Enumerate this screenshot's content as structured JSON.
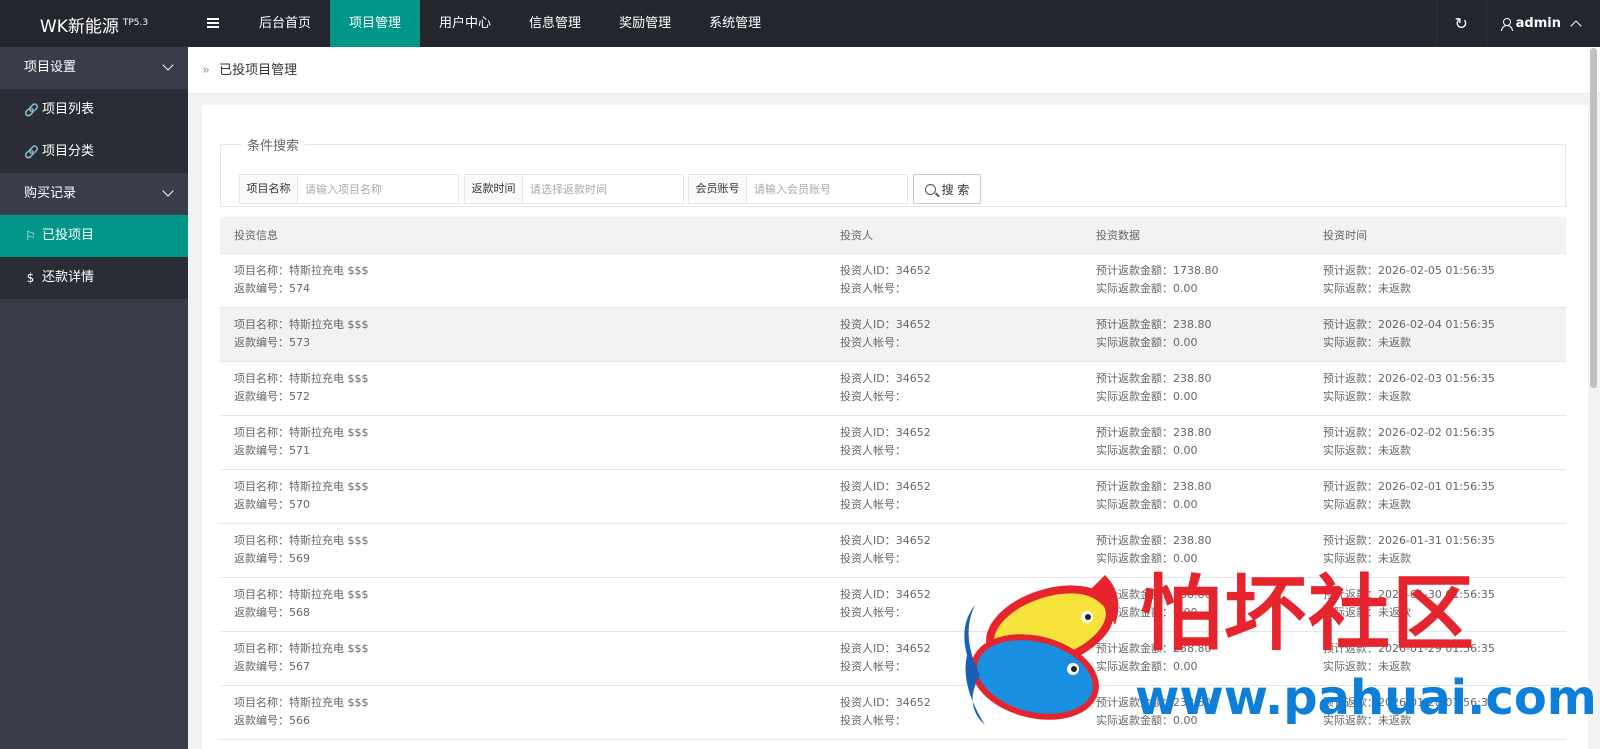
{
  "header": {
    "logo": "WK新能源",
    "version": "TP5.3",
    "nav": [
      {
        "label": "后台首页",
        "active": false
      },
      {
        "label": "项目管理",
        "active": true
      },
      {
        "label": "用户中心",
        "active": false
      },
      {
        "label": "信息管理",
        "active": false
      },
      {
        "label": "奖励管理",
        "active": false
      },
      {
        "label": "系统管理",
        "active": false
      }
    ],
    "refresh_icon": "↻",
    "user": "admin"
  },
  "sidebar": {
    "groups": [
      {
        "label": "项目设置",
        "items": [
          {
            "icon": "🔗",
            "label": "项目列表",
            "active": false
          },
          {
            "icon": "🔗",
            "label": "项目分类",
            "active": false
          }
        ]
      },
      {
        "label": "购买记录",
        "items": [
          {
            "icon": "⚐",
            "label": "已投项目",
            "active": true
          },
          {
            "icon": "$",
            "label": "还款详情",
            "active": false
          }
        ]
      }
    ]
  },
  "breadcrumb": {
    "current": "已投项目管理"
  },
  "search": {
    "legend": "条件搜索",
    "fields": [
      {
        "label": "项目名称",
        "placeholder": "请输入项目名称"
      },
      {
        "label": "返款时间",
        "placeholder": "请选择返款时间"
      },
      {
        "label": "会员账号",
        "placeholder": "请输入会员账号"
      }
    ],
    "button": "搜 索"
  },
  "table": {
    "columns": [
      "投资信息",
      "投资人",
      "投资数据",
      "投资时间"
    ],
    "rows": [
      {
        "name": "项目名称：特斯拉充电 $$$",
        "code": "返款编号：574",
        "inv_id": "投资人ID：34652",
        "inv_acct": "投资人帐号：",
        "est": "预计返款金额：1738.80",
        "act": "实际返款金额：0.00",
        "est_time": "预计返款：2026-02-05 01:56:35",
        "act_time": "实际返款：未返款"
      },
      {
        "name": "项目名称：特斯拉充电 $$$",
        "code": "返款编号：573",
        "inv_id": "投资人ID：34652",
        "inv_acct": "投资人帐号：",
        "est": "预计返款金额：238.80",
        "act": "实际返款金额：0.00",
        "est_time": "预计返款：2026-02-04 01:56:35",
        "act_time": "实际返款：未返款"
      },
      {
        "name": "项目名称：特斯拉充电 $$$",
        "code": "返款编号：572",
        "inv_id": "投资人ID：34652",
        "inv_acct": "投资人帐号：",
        "est": "预计返款金额：238.80",
        "act": "实际返款金额：0.00",
        "est_time": "预计返款：2026-02-03 01:56:35",
        "act_time": "实际返款：未返款"
      },
      {
        "name": "项目名称：特斯拉充电 $$$",
        "code": "返款编号：571",
        "inv_id": "投资人ID：34652",
        "inv_acct": "投资人帐号：",
        "est": "预计返款金额：238.80",
        "act": "实际返款金额：0.00",
        "est_time": "预计返款：2026-02-02 01:56:35",
        "act_time": "实际返款：未返款"
      },
      {
        "name": "项目名称：特斯拉充电 $$$",
        "code": "返款编号：570",
        "inv_id": "投资人ID：34652",
        "inv_acct": "投资人帐号：",
        "est": "预计返款金额：238.80",
        "act": "实际返款金额：0.00",
        "est_time": "预计返款：2026-02-01 01:56:35",
        "act_time": "实际返款：未返款"
      },
      {
        "name": "项目名称：特斯拉充电 $$$",
        "code": "返款编号：569",
        "inv_id": "投资人ID：34652",
        "inv_acct": "投资人帐号：",
        "est": "预计返款金额：238.80",
        "act": "实际返款金额：0.00",
        "est_time": "预计返款：2026-01-31 01:56:35",
        "act_time": "实际返款：未返款"
      },
      {
        "name": "项目名称：特斯拉充电 $$$",
        "code": "返款编号：568",
        "inv_id": "投资人ID：34652",
        "inv_acct": "投资人帐号：",
        "est": "预计返款金额：238.80",
        "act": "实际返款金额：0.00",
        "est_time": "预计返款：2026-01-30 01:56:35",
        "act_time": "实际返款：未返款"
      },
      {
        "name": "项目名称：特斯拉充电 $$$",
        "code": "返款编号：567",
        "inv_id": "投资人ID：34652",
        "inv_acct": "投资人帐号：",
        "est": "预计返款金额：238.80",
        "act": "实际返款金额：0.00",
        "est_time": "预计返款：2026-01-29 01:56:35",
        "act_time": "实际返款：未返款"
      },
      {
        "name": "项目名称：特斯拉充电 $$$",
        "code": "返款编号：566",
        "inv_id": "投资人ID：34652",
        "inv_acct": "投资人帐号：",
        "est": "预计返款金额：238.80",
        "act": "实际返款金额：0.00",
        "est_time": "预计返款：2026-01-28 01:56:35",
        "act_time": "实际返款：未返款"
      }
    ]
  },
  "watermark": {
    "title": "怕坏社区",
    "url": "www.pahuai.com"
  },
  "colors": {
    "accent": "#009688",
    "header_bg": "#23262e",
    "sidebar_bg": "#393d49",
    "sidebar_item_bg": "#2a2d35",
    "watermark_red": "#e5242d",
    "watermark_blue": "#0e7fd8"
  }
}
